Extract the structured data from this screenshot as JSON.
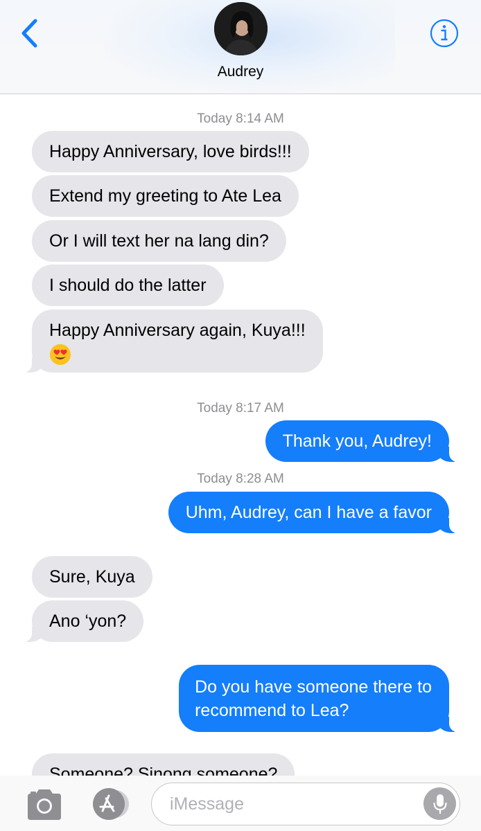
{
  "header": {
    "contact_name": "Audrey"
  },
  "messages": [
    {
      "timestamp": "Today 8:14 AM"
    },
    {
      "text": "Happy Anniversary, love birds!!!"
    },
    {
      "text": "Extend my greeting to Ate Lea"
    },
    {
      "text": "Or I will text her na lang din?"
    },
    {
      "text": "I should do the latter"
    },
    {
      "text": "Happy Anniversary again, Kuya!!!"
    },
    {
      "timestamp": "Today 8:17 AM"
    },
    {
      "text": "Thank you, Audrey!"
    },
    {
      "timestamp": "Today 8:28 AM"
    },
    {
      "text": "Uhm, Audrey, can I have a favor"
    },
    {
      "text": "Sure, Kuya"
    },
    {
      "text": "Ano ‘yon?"
    },
    {
      "text_line1": "Do you have someone there to",
      "text_line2": "recommend to Lea?"
    },
    {
      "text": "Someone? Sinong someone?"
    }
  ],
  "input": {
    "placeholder": "iMessage"
  },
  "colors": {
    "accent": "#147efb",
    "incoming_bubble": "#e5e5ea",
    "timestamp": "#8e8e93"
  },
  "icons": [
    "back-chevron-icon",
    "info-icon",
    "camera-icon",
    "app-store-icon",
    "microphone-icon",
    "heart-eyes-emoji"
  ]
}
